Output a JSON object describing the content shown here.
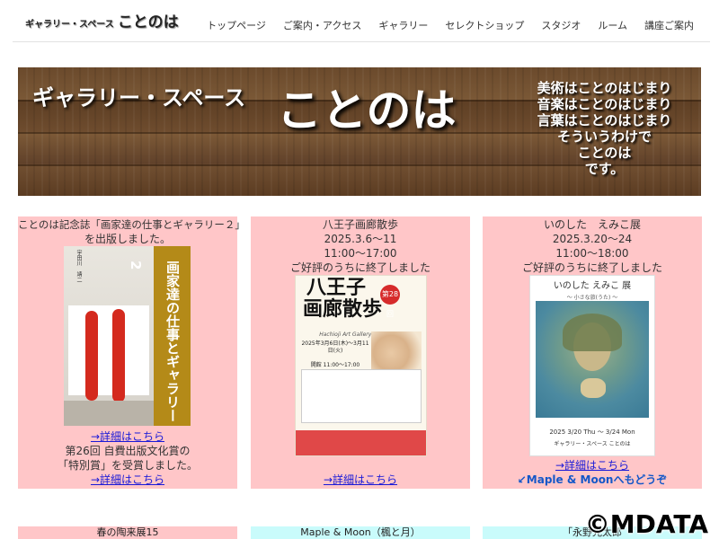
{
  "header": {
    "logo_small": "ギャラリー・スペース",
    "logo_big": "ことのは",
    "nav": [
      "トップページ",
      "ご案内・アクセス",
      "ギャラリー",
      "セレクトショップ",
      "スタジオ",
      "ルーム",
      "講座ご案内"
    ]
  },
  "banner": {
    "left": "ギャラリー・スペース",
    "main": "ことのは",
    "right_lines": [
      "美術はことのはじまり",
      "音楽はことのはじまり",
      "言葉はことのはじまり",
      "そういうわけで",
      "ことのは",
      "です。"
    ]
  },
  "cards": [
    {
      "lines": [
        "ことのは記念誌「画家達の仕事とギャラリー２」",
        "を出版しました。"
      ],
      "poster": {
        "author": "宇田川　靖二",
        "title": "画家達の仕事とギャラリー2"
      },
      "link1": "→詳細はこちら",
      "after_lines": [
        "第26回 自費出版文化賞の",
        "「特別賞」を受賞しました。"
      ],
      "link2": "→詳細はこちら"
    },
    {
      "lines": [
        "八王子画廊散歩",
        "2025.3.6〜11",
        "11:00〜17:00",
        "ご好評のうちに終了しました"
      ],
      "poster": {
        "title_top": "八王子",
        "title_bottom": "画廊散歩",
        "badge": "第28回",
        "sub": "Hachioji Art Gallery Walk 2025",
        "dates": "2025年3月6日(木)〜3月11日(火)",
        "hours": "開館 11:00〜17:00"
      },
      "link1": "→詳細はこちら"
    },
    {
      "lines": [
        "いのした　えみこ展",
        "2025.3.20〜24",
        "11:00〜18:00",
        "ご好評のうちに終了しました"
      ],
      "poster": {
        "title": "いのした えみこ 展",
        "subtitle": "〜 小さな旅(うた) 〜",
        "dates": "2025  3/20 Thu 〜 3/24 Mon",
        "gallery": "ギャラリー・スペース ことのは"
      },
      "link1": "→詳細はこちら",
      "link2": "↙Maple & Moonへもどうぞ"
    }
  ],
  "next_row": [
    "春の陶来展15",
    "Maple & Moon（楓と月）",
    "「永野光太郎"
  ],
  "watermark": "©MDATA",
  "colors": {
    "card_pink": "#ffc6c8",
    "card_cyan": "#c9fbfb",
    "link": "#1a1ad8",
    "link_bold": "#1457c8"
  }
}
